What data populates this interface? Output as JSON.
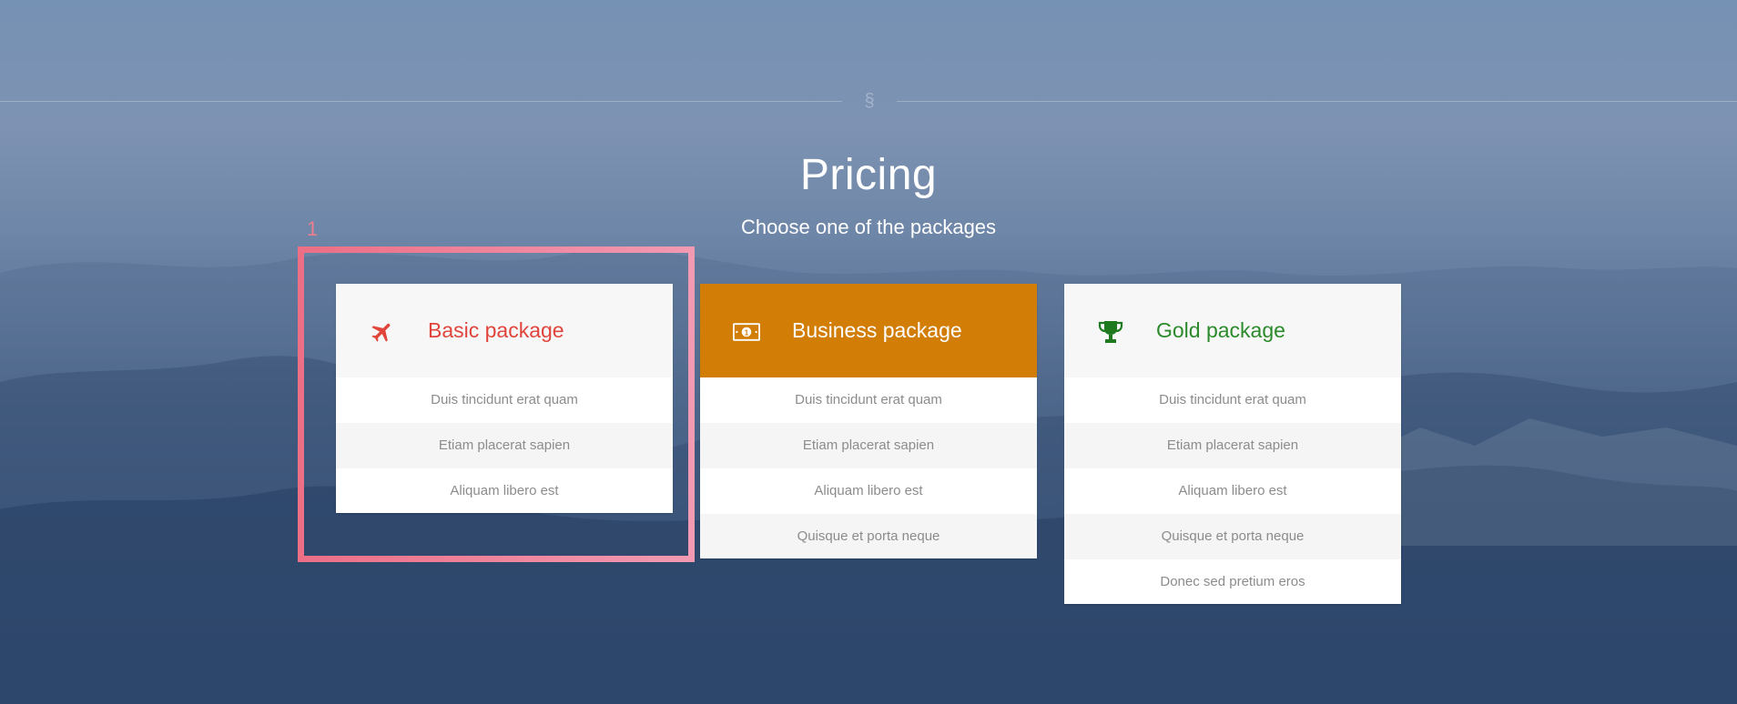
{
  "divider": {
    "symbol": "§"
  },
  "header": {
    "title": "Pricing",
    "subtitle": "Choose one of the packages"
  },
  "colors": {
    "basic_accent": "#e0443b",
    "business_accent": "#d17d06",
    "gold_accent": "#2b8a2b",
    "highlight": "#ee7d90"
  },
  "packages": [
    {
      "name": "Basic package",
      "icon": "airplane-icon",
      "features": [
        "Duis tincidunt erat quam",
        "Etiam placerat sapien",
        "Aliquam libero est"
      ]
    },
    {
      "name": "Business package",
      "icon": "money-bill-icon",
      "features": [
        "Duis tincidunt erat quam",
        "Etiam placerat sapien",
        "Aliquam libero est",
        "Quisque et porta neque"
      ]
    },
    {
      "name": "Gold package",
      "icon": "trophy-icon",
      "features": [
        "Duis tincidunt erat quam",
        "Etiam placerat sapien",
        "Aliquam libero est",
        "Quisque et porta neque",
        "Donec sed pretium eros"
      ]
    }
  ],
  "annotation": {
    "label": "1"
  }
}
